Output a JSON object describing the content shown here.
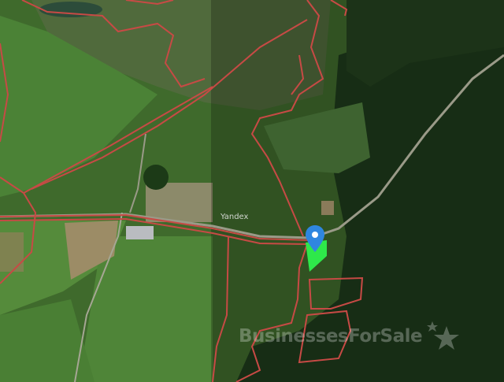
{
  "map": {
    "provider_label": "Yandex",
    "watermark_text": "BusinessesForSale",
    "watermark_icon": "stars-icon",
    "marker_icon": "location-pin-icon",
    "colors": {
      "boundary": "#c74a45",
      "parcel": "#2ee84a",
      "marker": "#2f86e0",
      "forest": "#203a1c",
      "field": "#4d7a34"
    }
  }
}
